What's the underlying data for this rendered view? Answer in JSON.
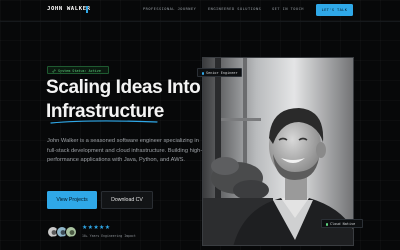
{
  "header": {
    "logo": "JOHN WALKER",
    "nav": [
      "PROFESSIONAL JOURNEY",
      "ENGINEERED SOLUTIONS",
      "GET IN TOUCH"
    ],
    "cta": "LET'S TALK"
  },
  "hero": {
    "status": "System Status: Active",
    "title_line1": "Scaling Ideas Into",
    "title_line2": "Infrastructure",
    "description": "John Walker is a seasoned software engineer specializing in full-stack development and cloud infrastructure. Building high-performance applications with Java, Python, and AWS.",
    "primary_button": "View Projects",
    "secondary_button": "Download CV",
    "rating_stars": "★★★★★",
    "rating_caption": "10+ Years Engineering Impact"
  },
  "photo": {
    "tag_top": "Senior Engineer",
    "tag_bottom": "Cloud Native"
  },
  "colors": {
    "accent": "#2fa8e8",
    "status_green": "#5ed47f",
    "background": "#070809"
  },
  "icons": {
    "status": "link-icon",
    "rating": "star-icon"
  }
}
